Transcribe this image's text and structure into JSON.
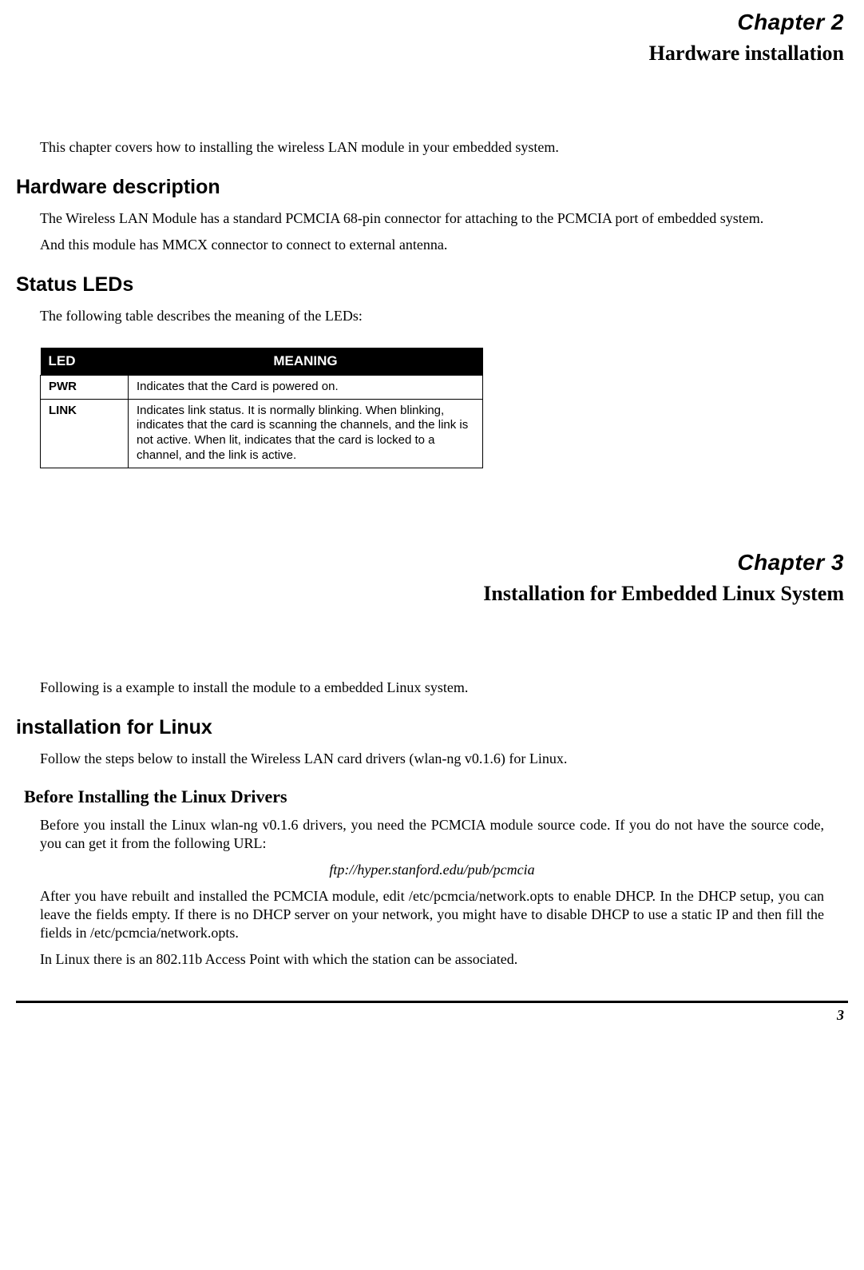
{
  "chapter2": {
    "label": "Chapter 2",
    "title": "Hardware installation",
    "intro": "This chapter covers how to installing the wireless LAN module in your embedded system.",
    "sections": {
      "hw_desc": {
        "heading": "Hardware description",
        "p1": "The Wireless LAN Module has a standard PCMCIA 68-pin connector for attaching to the PCMCIA port of embedded system.",
        "p2": "And this module has MMCX connector to connect to external antenna."
      },
      "status_leds": {
        "heading": "Status LEDs",
        "intro": "The following table describes the meaning of the LEDs:",
        "table": {
          "headers": {
            "led": "LED",
            "meaning": "MEANING"
          },
          "rows": [
            {
              "led": "PWR",
              "meaning": "Indicates that the Card is powered on."
            },
            {
              "led": "LINK",
              "meaning": "Indicates link status. It is normally blinking. When blinking, indicates that the card is scanning the channels, and the link is not active. When lit, indicates that the card is locked to a channel, and the link is active."
            }
          ]
        }
      }
    }
  },
  "chapter3": {
    "label": "Chapter 3",
    "title": "Installation for Embedded Linux System",
    "intro": "Following is a example to install the module to a embedded Linux system.",
    "sections": {
      "install_linux": {
        "heading": "installation for Linux",
        "p1": "Follow the steps below to install the Wireless LAN card drivers (wlan-ng v0.1.6) for Linux.",
        "sub": {
          "heading": "Before Installing the Linux Drivers",
          "p1": "Before you install the Linux wlan-ng v0.1.6 drivers, you need the PCMCIA module source code. If you do not have the source code, you can get it from the following URL:",
          "url": "ftp://hyper.stanford.edu/pub/pcmcia",
          "p2": "After you have rebuilt and installed the PCMCIA module, edit /etc/pcmcia/network.opts to enable DHCP. In the DHCP setup, you can leave the fields empty. If there is no DHCP server on your network, you might have to disable DHCP to use a static IP and then fill the fields in /etc/pcmcia/network.opts.",
          "p3": "In Linux there is an 802.11b Access Point with which the station can be associated."
        }
      }
    }
  },
  "page_number": "3"
}
